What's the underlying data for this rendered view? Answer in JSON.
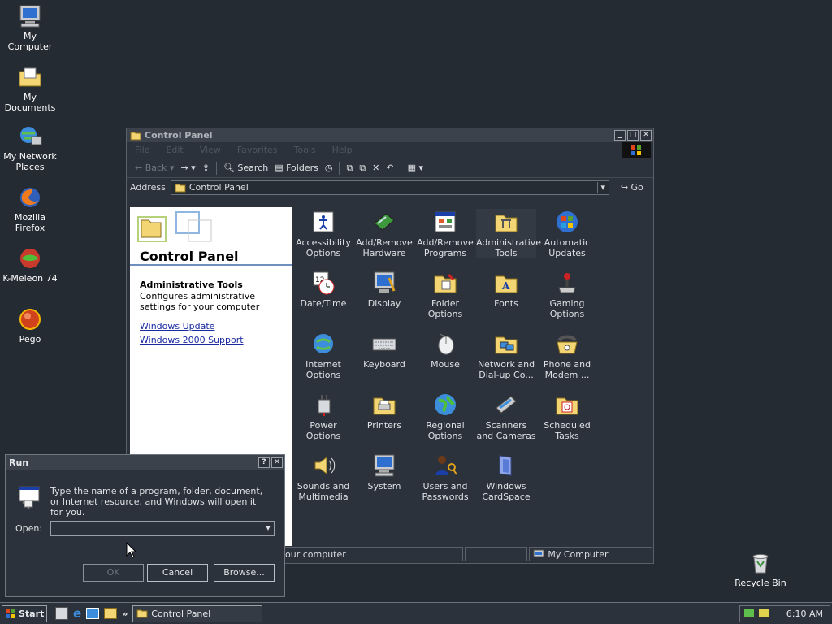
{
  "desktop": {
    "icons": [
      {
        "label": "My Computer"
      },
      {
        "label": "My Documents"
      },
      {
        "label": "My Network Places"
      },
      {
        "label": "Mozilla Firefox"
      },
      {
        "label": "K-Meleon 74"
      },
      {
        "label": "Pego"
      }
    ],
    "recycle_bin": "Recycle Bin"
  },
  "control_panel": {
    "title": "Control Panel",
    "menu": [
      "File",
      "Edit",
      "View",
      "Favorites",
      "Tools",
      "Help"
    ],
    "toolbar": {
      "back": "Back",
      "search": "Search",
      "folders": "Folders"
    },
    "address_label": "Address",
    "address_value": "Control Panel",
    "go": "Go",
    "left_panel": {
      "heading": "Control Panel",
      "selected_title": "Administrative Tools",
      "selected_desc": "Configures administrative settings for your computer",
      "links": [
        "Windows Update",
        "Windows 2000 Support"
      ]
    },
    "items": [
      {
        "label": "Accessibility Options"
      },
      {
        "label": "Add/Remove Hardware"
      },
      {
        "label": "Add/Remove Programs"
      },
      {
        "label": "Administrative Tools"
      },
      {
        "label": "Automatic Updates"
      },
      {
        "label": "Date/Time"
      },
      {
        "label": "Display"
      },
      {
        "label": "Folder Options"
      },
      {
        "label": "Fonts"
      },
      {
        "label": "Gaming Options"
      },
      {
        "label": "Internet Options"
      },
      {
        "label": "Keyboard"
      },
      {
        "label": "Mouse"
      },
      {
        "label": "Network and Dial-up Co..."
      },
      {
        "label": "Phone and Modem ..."
      },
      {
        "label": "Power Options"
      },
      {
        "label": "Printers"
      },
      {
        "label": "Regional Options"
      },
      {
        "label": "Scanners and Cameras"
      },
      {
        "label": "Scheduled Tasks"
      },
      {
        "label": "Sounds and Multimedia"
      },
      {
        "label": "System"
      },
      {
        "label": "Users and Passwords"
      },
      {
        "label": "Windows CardSpace"
      }
    ],
    "status_left": "our computer",
    "status_right": "My Computer"
  },
  "run_dialog": {
    "title": "Run",
    "help": "?",
    "close": "✕",
    "message": "Type the name of a program, folder, document, or Internet resource, and Windows will open it for you.",
    "open_label": "Open:",
    "open_value": "",
    "ok": "OK",
    "cancel": "Cancel",
    "browse": "Browse..."
  },
  "taskbar": {
    "start": "Start",
    "task": "Control Panel",
    "clock": "6:10 AM",
    "quick_launch_more": "»"
  }
}
